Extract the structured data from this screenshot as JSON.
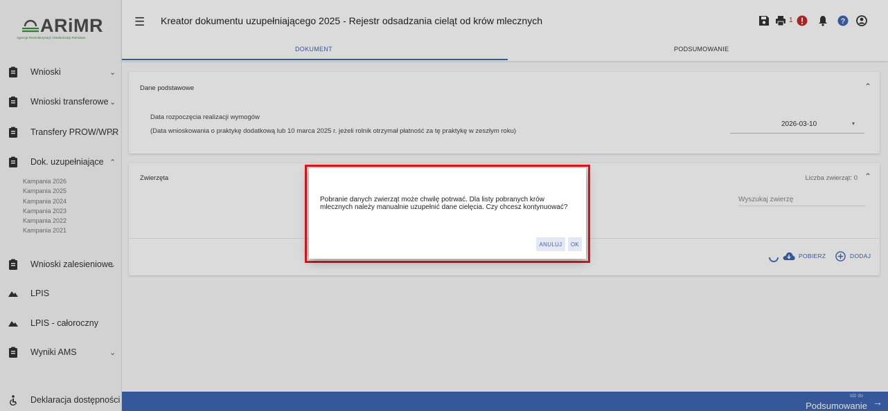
{
  "app": {
    "logo_text": "ARiMR",
    "logo_subtitle": "Agencja Restrukturyzacji i Modernizacji Rolnictwa",
    "title": "Kreator dokumentu uzupełniającego 2025 - Rejestr odsadzania cieląt od krów mlecznych"
  },
  "topbar": {
    "notification_count": "1",
    "icons": [
      "save-icon",
      "print-icon",
      "alert-icon",
      "bell-icon",
      "help-icon",
      "user-icon"
    ]
  },
  "tabs": [
    {
      "label": "DOKUMENT",
      "active": true
    },
    {
      "label": "PODSUMOWANIE",
      "active": false
    }
  ],
  "sidebar": {
    "items": [
      {
        "label": "Wnioski",
        "icon": "clipboard-icon",
        "chevron": "down"
      },
      {
        "label": "Wnioski transferowe",
        "icon": "clipboard-icon",
        "chevron": "down"
      },
      {
        "label": "Transfery PROW/WPR",
        "icon": "clipboard-icon",
        "chevron": "down"
      },
      {
        "label": "Dok. uzupełniające",
        "icon": "clipboard-icon",
        "chevron": "up"
      },
      {
        "label": "Wnioski zalesieniowe",
        "icon": "clipboard-icon",
        "chevron": "down"
      },
      {
        "label": "LPIS",
        "icon": "mountain-icon",
        "chevron": ""
      },
      {
        "label": "LPIS - całoroczny",
        "icon": "mountain-icon",
        "chevron": ""
      },
      {
        "label": "Wyniki AMS",
        "icon": "clipboard-icon",
        "chevron": "down"
      },
      {
        "label": "Deklaracja dostępności",
        "icon": "accessibility-icon",
        "chevron": ""
      }
    ],
    "sub_items": [
      "Kampania 2026",
      "Kampania 2025",
      "Kampania 2024",
      "Kampania 2023",
      "Kampania 2022",
      "Kampania 2021"
    ]
  },
  "panel_basic": {
    "heading": "Dane podstawowe",
    "field_label": "Data rozpoczęcia realizacji wymogów",
    "field_note": "(Data wnioskowania o praktykę dodatkową lub 10 marca 2025 r. jeżeli rolnik otrzymał płatność za tę praktykę w zeszłym roku)",
    "date_value": "2026-03-10"
  },
  "panel_animals": {
    "heading": "Zwierzęta",
    "count_label": "Liczba zwierząt: 0",
    "search_placeholder": "Wyszukaj zwierzę",
    "fetch_label": "POBIERZ",
    "add_label": "DODAJ"
  },
  "bottombar": {
    "small_label": "Idź do",
    "big_label": "Podsumowanie"
  },
  "modal": {
    "message": "Pobranie danych zwierząt może chwilę potrwać. Dla listy pobranych krów mlecznych należy manualnie uzupełnić dane cielęcia. Czy chcesz kontynuować?",
    "cancel_label": "ANULUJ",
    "ok_label": "OK"
  },
  "colors": {
    "primary": "#3f66b3",
    "alert": "#c62828",
    "highlight_frame": "#e0141b",
    "logo_green": "#3a8f3a"
  }
}
